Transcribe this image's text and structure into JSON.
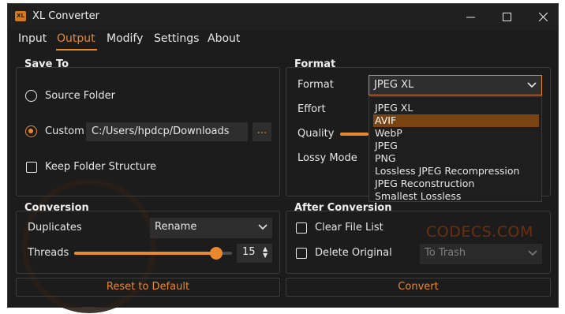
{
  "window": {
    "title": "XL Converter",
    "icon_text": "XL"
  },
  "menu": [
    "Input",
    "Output",
    "Modify",
    "Settings",
    "About"
  ],
  "save_to": {
    "title": "Save To",
    "source_folder": "Source Folder",
    "custom": "Custom",
    "custom_path": "C:/Users/hpdcp/Downloads",
    "browse": "...",
    "keep_structure": "Keep Folder Structure"
  },
  "format": {
    "title": "Format",
    "format_label": "Format",
    "selected": "JPEG XL",
    "effort_label": "Effort",
    "quality_label": "Quality",
    "lossy_label": "Lossy Mode",
    "options": [
      "JPEG XL",
      "AVIF",
      "WebP",
      "JPEG",
      "PNG",
      "Lossless JPEG Recompression",
      "JPEG Reconstruction",
      "Smallest Lossless"
    ],
    "highlighted": "AVIF"
  },
  "conversion": {
    "title": "Conversion",
    "duplicates_label": "Duplicates",
    "duplicates_value": "Rename",
    "threads_label": "Threads",
    "threads_value": "15",
    "threads_fraction": 0.9
  },
  "after_conversion": {
    "title": "After Conversion",
    "clear_file_list": "Clear File List",
    "delete_original": "Delete Original",
    "delete_mode": "To Trash"
  },
  "buttons": {
    "reset": "Reset to Default",
    "convert": "Convert"
  },
  "watermark": "CODECS.COM",
  "colors": {
    "accent": "#e8892d",
    "background": "#1c1c1c",
    "field": "#2e2e2e"
  }
}
